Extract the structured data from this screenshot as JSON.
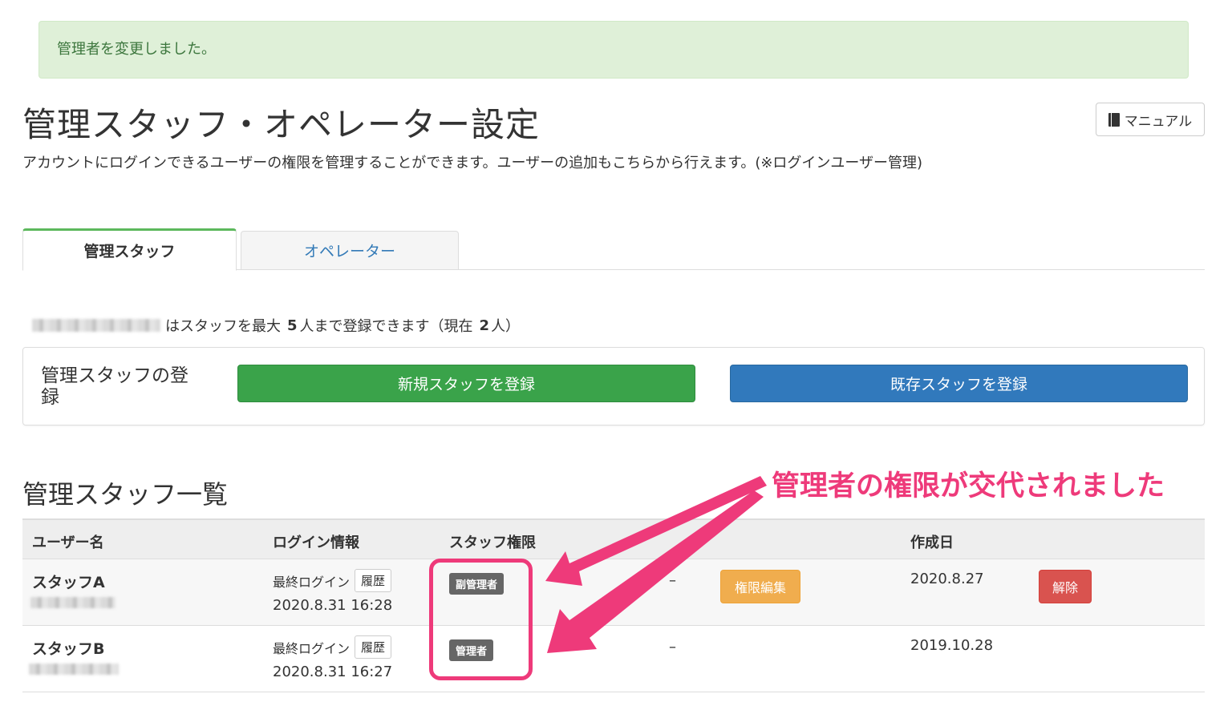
{
  "alert": {
    "message": "管理者を変更しました。"
  },
  "header": {
    "title": "管理スタッフ・オペレーター設定",
    "manual_label": "マニュアル",
    "description": "アカウントにログインできるユーザーの権限を管理することができます。ユーザーの追加もこちらから行えます。(※ログインユーザー管理)"
  },
  "tabs": [
    {
      "label": "管理スタッフ",
      "active": true
    },
    {
      "label": "オペレーター",
      "active": false
    }
  ],
  "limit": {
    "prefix": "はスタッフを最大",
    "max": "5",
    "mid": "人まで登録できます（現在",
    "current": "2",
    "suffix": "人）"
  },
  "register": {
    "label": "管理スタッフの登録",
    "new_button": "新規スタッフを登録",
    "existing_button": "既存スタッフを登録"
  },
  "list": {
    "title": "管理スタッフ一覧",
    "annotation": "管理者の権限が交代されました",
    "headers": {
      "username": "ユーザー名",
      "login": "ログイン情報",
      "role": "スタッフ権限",
      "created": "作成日"
    },
    "rows": [
      {
        "name": "スタッフA",
        "login_label": "最終ログイン",
        "history_label": "履歴",
        "last_login": "2020.8.31 16:28",
        "role": "副管理者",
        "dash": "–",
        "edit_label": "権限編集",
        "created": "2020.8.27",
        "remove_label": "解除"
      },
      {
        "name": "スタッフB",
        "login_label": "最終ログイン",
        "history_label": "履歴",
        "last_login": "2020.8.31 16:27",
        "role": "管理者",
        "dash": "–",
        "created": "2019.10.28"
      }
    ]
  },
  "colors": {
    "alert_bg": "#dff0d8",
    "success": "#3aa34a",
    "primary": "#3179bc",
    "warning": "#f0ad4e",
    "danger": "#d9534f",
    "annotation": "#ee3a7a"
  }
}
